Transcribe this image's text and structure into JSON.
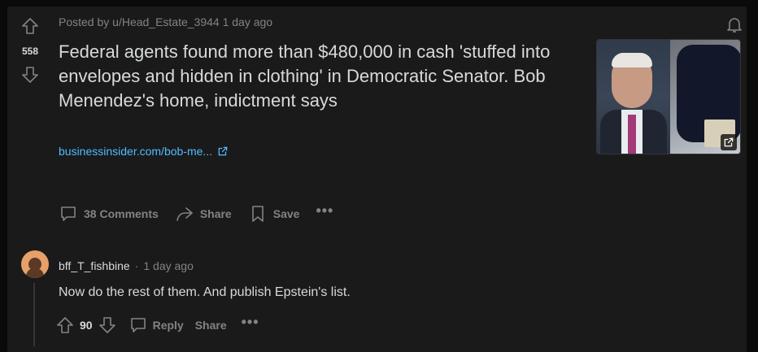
{
  "post": {
    "score": "558",
    "meta": "Posted by u/Head_Estate_3944 1 day ago",
    "title": "Federal agents found more than $480,000 in cash 'stuffed into envelopes and hidden in clothing' in Democratic Senator. Bob Menendez's home, indictment says",
    "link_text": "businessinsider.com/bob-me...",
    "comments_label": "38 Comments",
    "share_label": "Share",
    "save_label": "Save",
    "more_label": "•••"
  },
  "comment": {
    "author": "bff_T_fishbine",
    "separator": "·",
    "time": "1 day ago",
    "body": "Now do the rest of them. And publish Epstein's list.",
    "score": "90",
    "reply_label": "Reply",
    "share_label": "Share",
    "more_label": "•••"
  },
  "colors": {
    "background": "#1a1a1b",
    "text": "#d7dadc",
    "muted": "#818384",
    "link": "#4fbcff"
  },
  "icons": [
    "upvote-icon",
    "downvote-icon",
    "bell-icon",
    "external-link-icon",
    "comment-icon",
    "share-icon",
    "bookmark-icon"
  ]
}
